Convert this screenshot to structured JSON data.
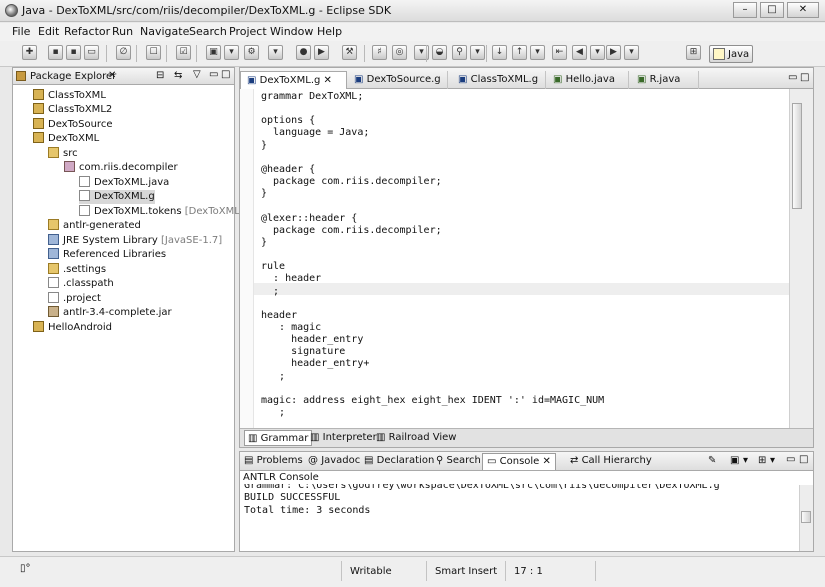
{
  "window": {
    "title": "Java - DexToXML/src/com/riis/decompiler/DexToXML.g - Eclipse SDK",
    "min_label": "–",
    "max_label": "□",
    "close_label": "✕"
  },
  "menu": [
    "File",
    "Edit",
    "Refactor",
    "Run",
    "Navigate",
    "Search",
    "Project",
    "Window",
    "Help"
  ],
  "perspective": {
    "label": "Java"
  },
  "package_explorer": {
    "title": "Package Explorer",
    "tree": [
      {
        "label": "ClassToXML",
        "icon": "project-folder-icon"
      },
      {
        "label": "ClassToXML2",
        "icon": "project-folder-icon"
      },
      {
        "label": "DexToSource",
        "icon": "project-folder-icon"
      },
      {
        "label": "DexToXML",
        "icon": "project-folder-icon"
      },
      {
        "label": "src",
        "icon": "source-folder-icon"
      },
      {
        "label": "com.riis.decompiler",
        "icon": "package-icon"
      },
      {
        "label": "DexToXML.java",
        "icon": "java-file-icon"
      },
      {
        "label": "DexToXML.g",
        "icon": "grammar-file-icon"
      },
      {
        "label": "DexToXML.tokens",
        "suffix": "[DexToXML.g]",
        "icon": "file-icon"
      },
      {
        "label": "antlr-generated",
        "icon": "source-folder-icon"
      },
      {
        "label": "JRE System Library",
        "suffix": "[JavaSE-1.7]",
        "icon": "library-icon"
      },
      {
        "label": "Referenced Libraries",
        "icon": "library-icon"
      },
      {
        "label": ".settings",
        "icon": "folder-icon"
      },
      {
        "label": ".classpath",
        "icon": "xml-file-icon"
      },
      {
        "label": ".project",
        "icon": "xml-file-icon"
      },
      {
        "label": "antlr-3.4-complete.jar",
        "icon": "jar-icon"
      },
      {
        "label": "HelloAndroid",
        "icon": "project-folder-icon"
      }
    ]
  },
  "editor": {
    "tabs": [
      "DexToXML.g",
      "DexToSource.g",
      "ClassToXML.g",
      "Hello.java",
      "R.java"
    ],
    "code": "grammar DexToXML;\n\noptions {\n  language = Java;\n}\n\n@header {\n  package com.riis.decompiler;\n}\n\n@lexer::header {\n  package com.riis.decompiler;\n}\n\nrule\n  : header\n  ;\n\nheader\n   : magic\n     header_entry\n     signature\n     header_entry+\n   ;\n\nmagic: address eight_hex eight_hex IDENT ':' id=MAGIC_NUM\n   ;",
    "bottom_tabs": [
      "Grammar",
      "Interpreter",
      "Railroad View"
    ]
  },
  "console": {
    "tabs": [
      "Problems",
      "Javadoc",
      "Declaration",
      "Search",
      "Console",
      "Call Hierarchy"
    ],
    "name": "ANTLR Console",
    "lines": [
      "Grammar: C:\\Users\\godfrey\\workspace\\DexToXML\\src\\com\\riis\\decompiler\\DexToXML.g",
      "BUILD SUCCESSFUL",
      "Total time: 3 seconds"
    ]
  },
  "status": {
    "writable": "Writable",
    "insert_mode": "Smart Insert",
    "position": "17 : 1"
  }
}
